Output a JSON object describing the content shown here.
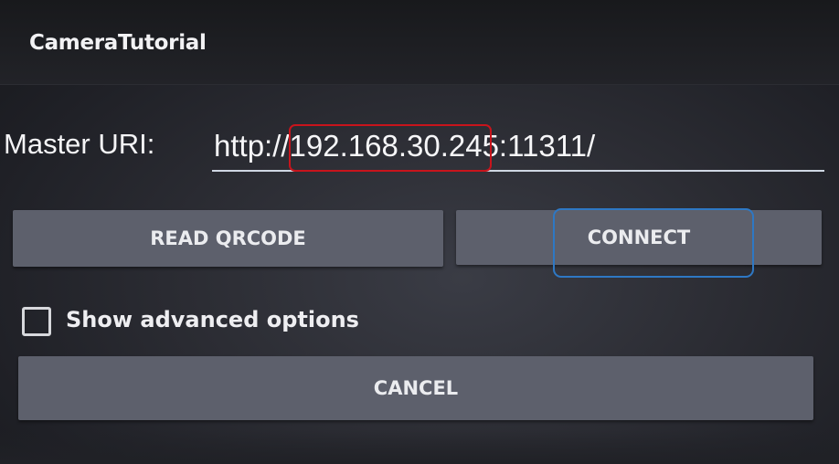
{
  "app": {
    "title": "CameraTutorial"
  },
  "form": {
    "master_uri_label": "Master URI:",
    "master_uri_value": "http://192.168.30.245:11311/"
  },
  "buttons": {
    "read_qrcode": "READ QRCODE",
    "connect": "CONNECT",
    "cancel": "CANCEL"
  },
  "options": {
    "show_advanced_label": "Show advanced options",
    "show_advanced_checked": false
  },
  "colors": {
    "button_bg": "#5d606c",
    "ip_highlight": "#c8141c",
    "connect_highlight": "#2e78c4"
  }
}
